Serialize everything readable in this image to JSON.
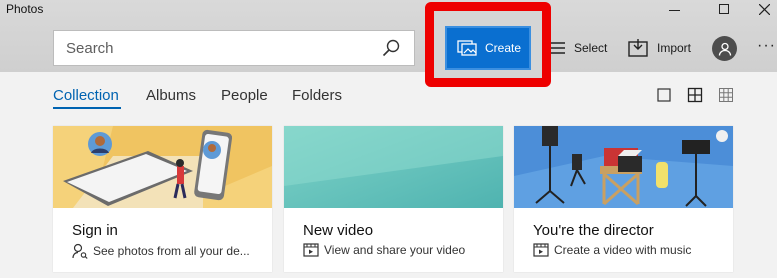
{
  "window": {
    "title": "Photos"
  },
  "toolbar": {
    "search_placeholder": "Search",
    "create_label": "Create",
    "select_label": "Select",
    "import_label": "Import",
    "more_label": "···"
  },
  "tabs": [
    {
      "label": "Collection",
      "active": true
    },
    {
      "label": "Albums"
    },
    {
      "label": "People"
    },
    {
      "label": "Folders"
    }
  ],
  "view_icons": [
    "large-tiles-icon",
    "medium-tiles-icon",
    "small-tiles-icon"
  ],
  "cards": [
    {
      "title": "Sign in",
      "subtitle": "See photos from all your de...",
      "icon": "sign-in-person-icon"
    },
    {
      "title": "New video",
      "subtitle": "View and share your video",
      "icon": "video-icon"
    },
    {
      "title": "You're the director",
      "subtitle": "Create a video with music",
      "icon": "video-icon"
    }
  ],
  "colors": {
    "accent": "#0063b1",
    "create_button": "#0a6fd0",
    "highlight_border": "#ee0000"
  }
}
